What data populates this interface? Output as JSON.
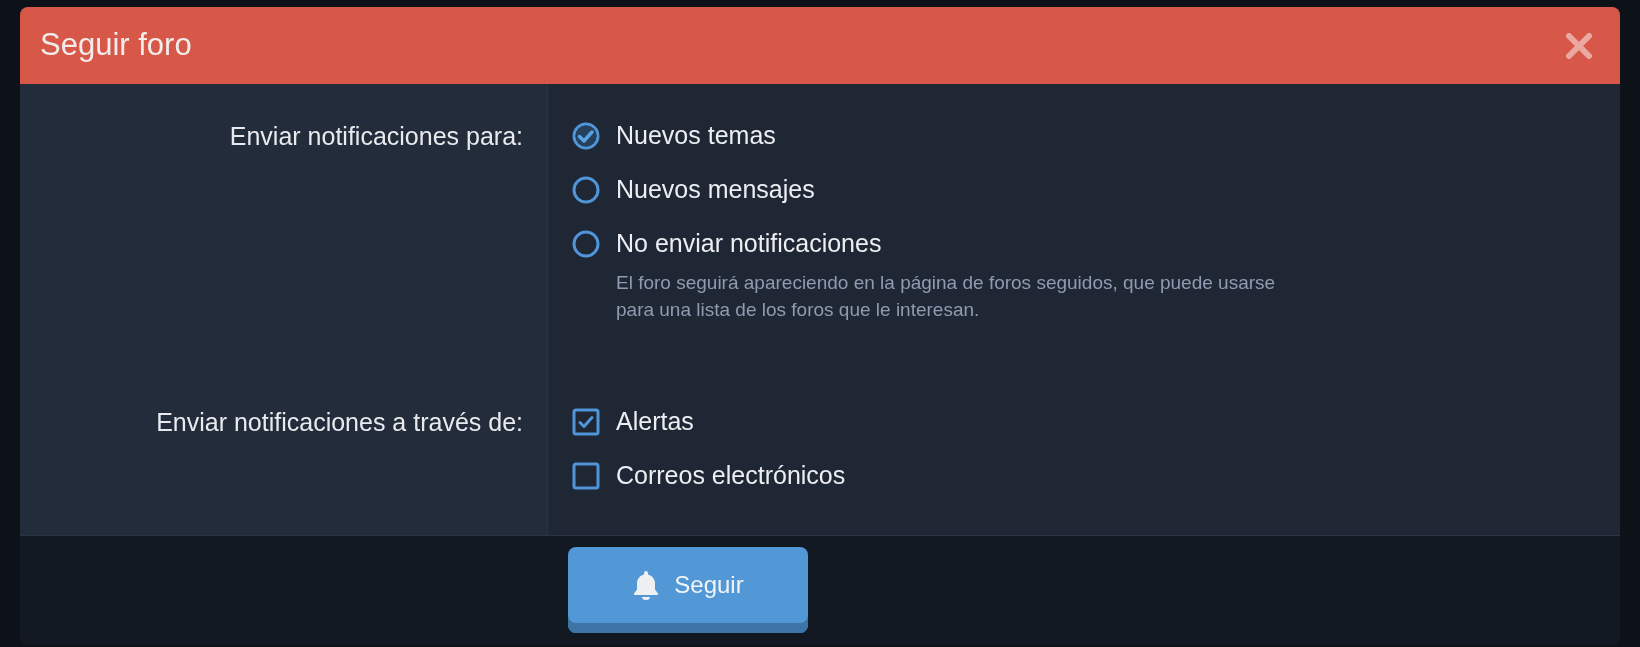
{
  "dialog": {
    "title": "Seguir foro"
  },
  "sections": [
    {
      "label": "Enviar notificaciones para:",
      "kind": "radio",
      "options": [
        {
          "label": "Nuevos temas",
          "selected": true
        },
        {
          "label": "Nuevos mensajes",
          "selected": false
        },
        {
          "label": "No enviar notificaciones",
          "selected": false,
          "hint": "El foro seguirá apareciendo en la página de foros seguidos, que puede usarse para una lista de los foros que le interesan."
        }
      ]
    },
    {
      "label": "Enviar notificaciones a través de:",
      "kind": "checkbox",
      "options": [
        {
          "label": "Alertas",
          "checked": true
        },
        {
          "label": "Correos electrónicos",
          "checked": false
        }
      ]
    }
  ],
  "submit_button": {
    "label": "Seguir"
  }
}
